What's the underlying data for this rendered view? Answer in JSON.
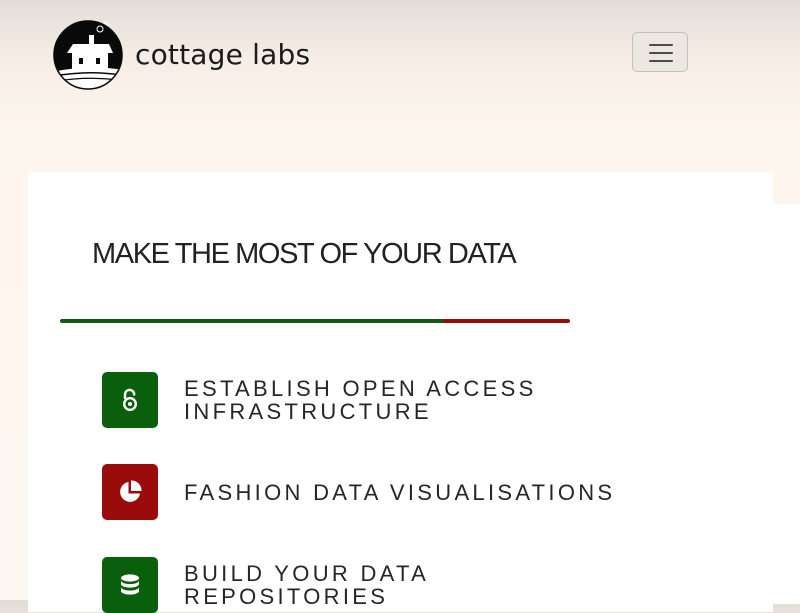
{
  "navbar": {
    "brand_name": "cottage labs",
    "logo_icon": "cottage-labs-logo",
    "menu_icon": "hamburger-menu-icon"
  },
  "main": {
    "headline": "MAKE THE MOST OF YOUR DATA",
    "rule_colors": [
      "#0f5c12",
      "#990c0c"
    ],
    "services": [
      {
        "label": "ESTABLISH OPEN ACCESS INFRASTRUCTURE",
        "icon": "open-access-icon",
        "color": "#0a5f0c"
      },
      {
        "label": "FASHION DATA VISUALISATIONS",
        "icon": "pie-chart-icon",
        "color": "#9a0b0b"
      },
      {
        "label": "BUILD YOUR DATA REPOSITORIES",
        "icon": "database-icon",
        "color": "#0a5f0c"
      }
    ]
  }
}
